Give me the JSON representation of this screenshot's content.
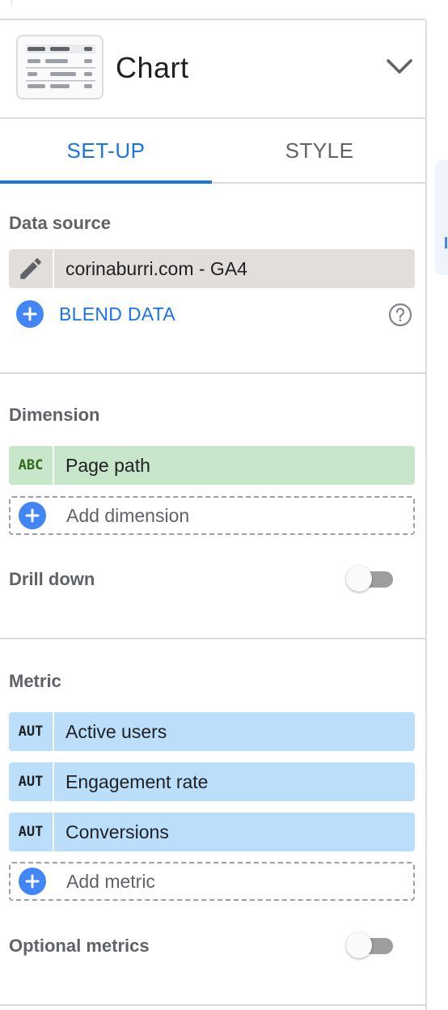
{
  "header": {
    "title": "Chart",
    "chart_type_icon": "table-chart-icon",
    "expand_icon": "chevron-down-icon"
  },
  "tabs": [
    {
      "label": "SET-UP",
      "active": true
    },
    {
      "label": "STYLE",
      "active": false
    }
  ],
  "data_source": {
    "section_label": "Data source",
    "edit_icon": "pencil-icon",
    "name": "corinaburri.com - GA4",
    "blend_label": "BLEND DATA",
    "help_icon": "help-circle-icon"
  },
  "dimension": {
    "section_label": "Dimension",
    "items": [
      {
        "type": "ABC",
        "label": "Page path"
      }
    ],
    "add_label": "Add dimension",
    "drill_down_label": "Drill down",
    "drill_down_enabled": false
  },
  "metric": {
    "section_label": "Metric",
    "items": [
      {
        "type": "AUT",
        "label": "Active users"
      },
      {
        "type": "AUT",
        "label": "Engagement rate"
      },
      {
        "type": "AUT",
        "label": "Conversions"
      }
    ],
    "add_label": "Add metric",
    "optional_label": "Optional metrics",
    "optional_enabled": false
  },
  "colors": {
    "accent": "#1a73e8",
    "dimension_chip": "#c8e6c9",
    "metric_chip": "#bbdefb",
    "source_chip": "#e2dedb"
  }
}
